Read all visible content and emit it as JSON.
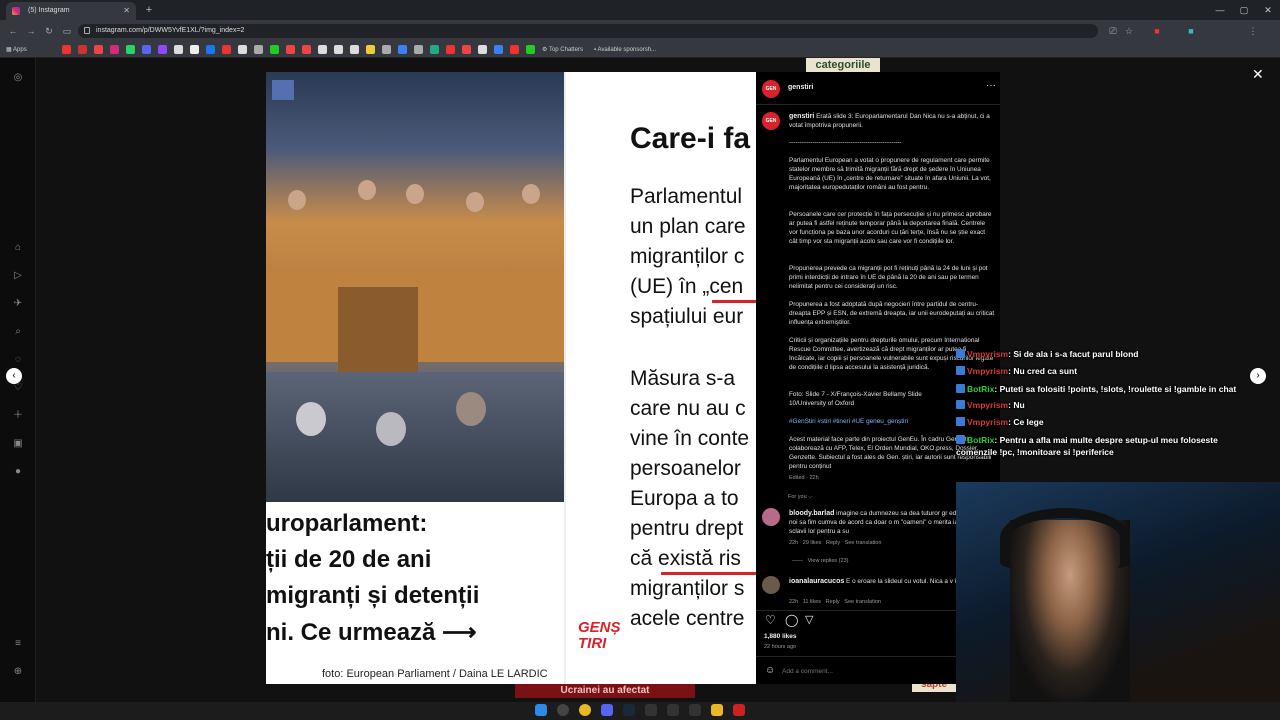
{
  "browser": {
    "tab_title": "(5) Instagram",
    "url": "instagram.com/p/DWW5YvfE1XL/?img_index=2",
    "bookmarks": {
      "apps": "Apps",
      "top_chatters": "Top Chatters",
      "sponsorship": "Available sponsorsh..."
    }
  },
  "post": {
    "photo_credit": "foto: European Parliament / Daina LE LARDIC",
    "left_lines": [
      "uroparlament:",
      "ții de 20 de ani",
      "migranți și detenții",
      "ni. Ce urmează"
    ],
    "right_title": "Care-i fa",
    "right_lines_1": [
      "Parlamentul",
      "un plan care",
      "migranților c",
      "(UE) în „cen",
      "spațiului eur"
    ],
    "right_lines_2": [
      "Măsura s-a",
      "care nu au c",
      "vine în conte",
      "persoanelor",
      "Europa a to",
      "pentru drept",
      "că există ris",
      "migranților s",
      "acele centre"
    ],
    "logo": "GENȘTIRI"
  },
  "panel": {
    "account": "genstiri",
    "caption_user": "genstiri",
    "caption_lead": "Erată slide 3: Europarlamentarul Dan Nica nu s-a abținut, ci a votat împotriva propunerii.",
    "separator": "-----------------------------------------------------",
    "paragraphs": [
      "Parlamentul European a votat o propunere de regulament care permite statelor membre să trimită migranții fără drept de ședere în Uniunea Europeană (UE) în „centre de returnare” situate în afara Uniunii. La vot, majoritatea europedutaților români au fost pentru.",
      "Persoanele care cer protecție în fața persecuției și nu primesc aprobare ar putea fi astfel reținute temporar până la deportarea finală. Centrele vor funcționa pe baza unor acorduri cu țări terțe, însă nu se știe exact cât timp vor sta migranții acolo sau care vor fi condițiile lor.",
      "Propunerea prevede ca migranții pot fi reținuți până la 24 de luni și pot primi interdicții de intrare în UE de până la 20 de ani sau pe termen nelimitat pentru cei considerați un risc.",
      "Propunerea a fost adoptată după negocieri între partidul de centru-dreapta EPP și ESN, de extremă dreapta, iar unii eurodeputați au criticat influența extremiștilor.",
      "Criticii și organizațiile pentru drepturile omului, precum International Rescue Committee, avertizează că drept migranților ar putea fi încălcate, iar copiii și persoanele vulnerabile sunt expuși riscurilor legate de condițiile d lipsa accesului la asistență juridică.",
      "Foto: Slide 7 - X/François-Xavier Bellamy Slide 10/University of Oxford"
    ],
    "hashtags": "#GenStiri #stiri #tineri #UE geneu_genștiri",
    "footer_text": "Acest material face parte din proiectul GenEu. În cadru Gen. știri colaborează cu AFP, Telex, El Orden Mundial, OKO.press, Dossier, Genzette. Subiectul a fost ales de Gen. știri, iar autorii sunt responsabili pentru conținut",
    "edited": "Edited · 22h",
    "for_you": "For you ⌵",
    "comments": [
      {
        "user": "bloody.barlad",
        "text": "imagine ca dumnezeu sa dea tuturor gr edenului aici iar noi sa fim cumva de acord ca doar o m \"oameni\" o merita iar restu sa fie sclavii lor pentru a su",
        "time": "22h",
        "likes": "29 likes",
        "reply": "Reply",
        "translate": "See translation",
        "view_replies": "View replies (23)"
      },
      {
        "user": "ioanalauracucos",
        "text": "E o eroare la slideul cu votul. Nica a v împotrivă.",
        "time": "22h",
        "likes": "11 likes",
        "reply": "Reply",
        "translate": "See translation"
      }
    ],
    "likes": "1,880 likes",
    "posted": "22 hours ago",
    "add_comment_placeholder": "Add a comment..."
  },
  "overlay": {
    "top_banner": "categoriile",
    "bottom_banner": "Ucrainei au afectat",
    "bottom_right": "sapte"
  },
  "chat": [
    {
      "user": "Vmpyrism",
      "user_color": "#d43b3b",
      "msg": "Si de ala i s-a facut parul blond"
    },
    {
      "user": "Vmpyrism",
      "user_color": "#d43b3b",
      "msg": "Nu cred ca sunt"
    },
    {
      "user": "BotRix",
      "user_color": "#2ecc40",
      "msg": "Puteti sa folositi !points, !slots, !roulette si !gamble in chat"
    },
    {
      "user": "Vmpyrism",
      "user_color": "#d43b3b",
      "msg": "Nu"
    },
    {
      "user": "Vmpyrism",
      "user_color": "#d43b3b",
      "msg": "Ce lege"
    },
    {
      "user": "BotRix",
      "user_color": "#2ecc40",
      "msg": "Pentru a afla mai multe despre setup-ul meu foloseste comenzile !pc, !monitoare si !periferice"
    }
  ]
}
